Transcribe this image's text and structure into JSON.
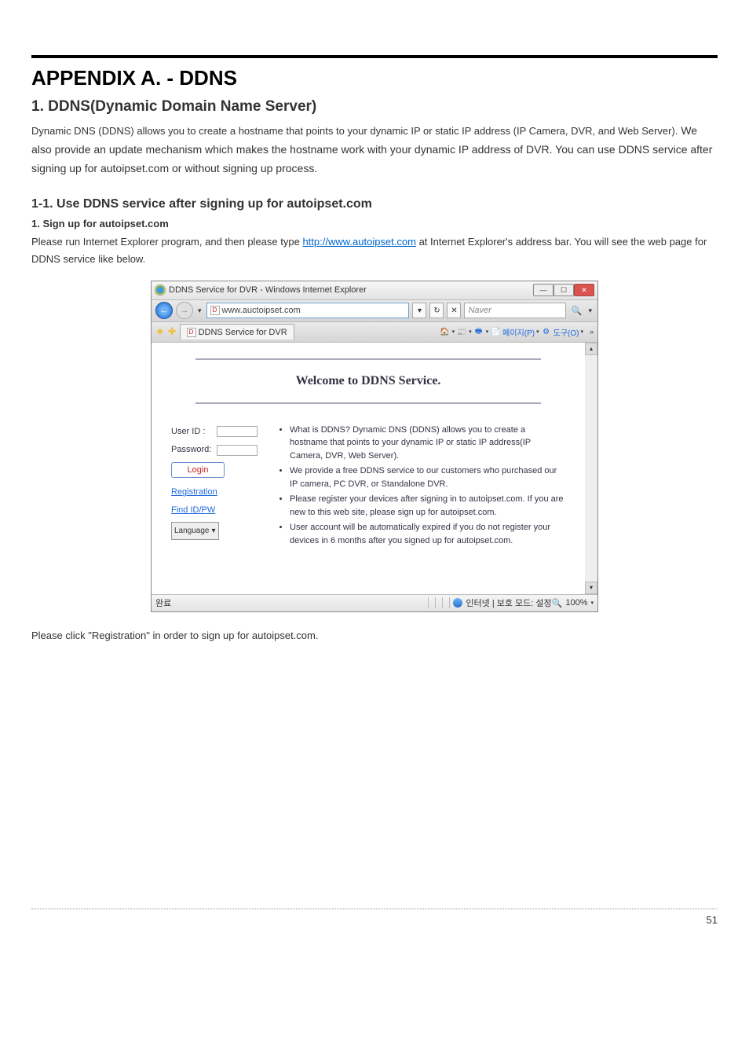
{
  "doc": {
    "appendix_title": "APPENDIX A. - DDNS",
    "section_title": "1. DDNS(Dynamic Domain Name Server)",
    "intro_first": "Dynamic DNS (DDNS) allows you to create a hostname that points to your dynamic IP or static IP address (IP Camera, DVR, and Web Server).",
    "intro_rest": " We also provide an update mechanism which makes the hostname work with your dynamic IP address of DVR. You can use DDNS service after signing up for autoipset.com or without signing up process.",
    "subsection_title": "1-1. Use DDNS service after signing up for autoipset.com",
    "step1_title": "1. Sign up for autoipset.com",
    "step1_text_before": "Please run Internet Explorer program, and then please type ",
    "step1_link": "http://www.autoipset.com",
    "step1_text_after": " at Internet Explorer's address bar. You will see the web page for DDNS service like below.",
    "after_image": "Please click \"Registration\" in order to sign up for autoipset.com.",
    "page_number": "51"
  },
  "browser": {
    "window_title": "DDNS Service for DVR - Windows Internet Explorer",
    "address": "www.auctoipset.com",
    "search_placeholder": "Naver",
    "tab_title": "DDNS Service for DVR",
    "cmdbar_page": "페이지(P)",
    "cmdbar_tools": "도구(O)"
  },
  "page": {
    "welcome": "Welcome to DDNS Service.",
    "userid_label": "User ID :",
    "password_label": "Password:",
    "login_btn": "Login",
    "registration": "Registration",
    "find_idpw": "Find ID/PW",
    "language": "Language",
    "bullets": [
      "What is DDNS? Dynamic DNS (DDNS) allows you to create a hostname that points to your dynamic IP or static IP address(IP Camera, DVR, Web Server).",
      "We provide a free DDNS service to our customers who purchased our IP camera, PC DVR, or Standalone DVR.",
      "Please register your devices after signing in to autoipset.com. If you are new to this web site, please sign up for autoipset.com.",
      "User account will be automatically expired if you do not register your devices in 6 months after you signed up for autoipset.com."
    ]
  },
  "status": {
    "left": "완료",
    "mid": "인터넷 | 보호 모드: 설정",
    "zoom": "100%"
  }
}
